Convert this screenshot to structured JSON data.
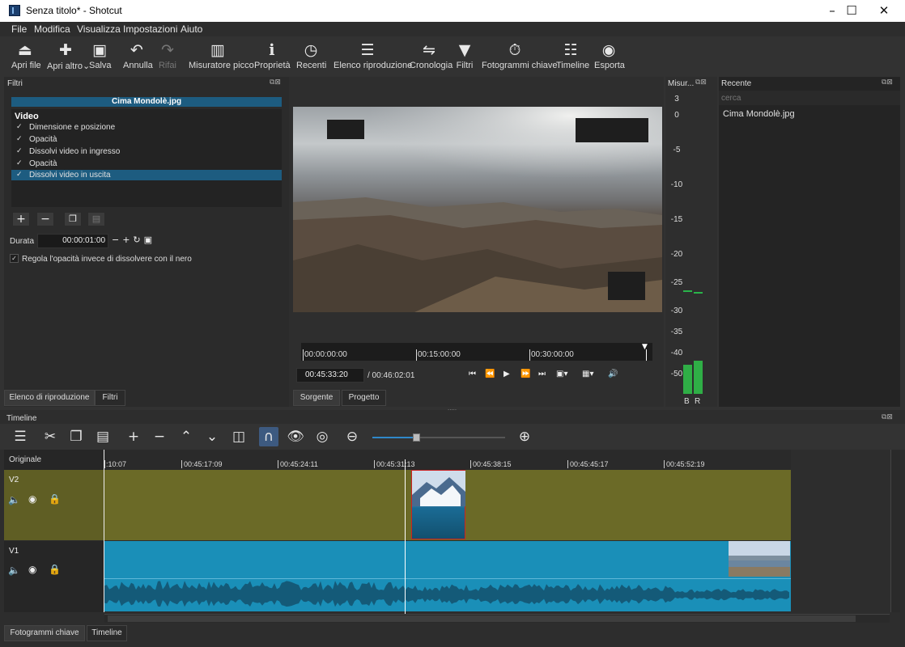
{
  "window": {
    "title": "Senza titolo* - Shotcut",
    "minimize": "–",
    "maximize": "☐",
    "close": "✕"
  },
  "menu": [
    "File",
    "Modifica",
    "Visualizza",
    "Impostazioni",
    "Aiuto"
  ],
  "toolbar": [
    {
      "label": "Apri file",
      "icon": "open-file-icon"
    },
    {
      "label": "Apri altro",
      "icon": "open-other-icon"
    },
    {
      "label": "Salva",
      "icon": "save-icon"
    },
    {
      "label": "Annulla",
      "icon": "undo-icon"
    },
    {
      "label": "Rifai",
      "icon": "redo-icon"
    },
    {
      "label": "Misuratore picco",
      "icon": "peak-meter-icon"
    },
    {
      "label": "Proprietà",
      "icon": "info-icon"
    },
    {
      "label": "Recenti",
      "icon": "clock-icon"
    },
    {
      "label": "Elenco riproduzione",
      "icon": "list-icon"
    },
    {
      "label": "Cronologia",
      "icon": "history-icon"
    },
    {
      "label": "Filtri",
      "icon": "filter-icon"
    },
    {
      "label": "Fotogrammi chiave",
      "icon": "stopwatch-icon"
    },
    {
      "label": "Timeline",
      "icon": "timeline-icon"
    },
    {
      "label": "Esporta",
      "icon": "export-icon"
    }
  ],
  "filters": {
    "panel_title": "Filtri",
    "clip_name": "Cima Mondolè.jpg",
    "section": "Video",
    "items": [
      {
        "label": "Dimensione e posizione",
        "checked": true,
        "selected": false
      },
      {
        "label": "Opacità",
        "checked": true,
        "selected": false
      },
      {
        "label": "Dissolvi video in ingresso",
        "checked": true,
        "selected": false
      },
      {
        "label": "Opacità",
        "checked": true,
        "selected": false
      },
      {
        "label": "Dissolvi video in uscita",
        "checked": true,
        "selected": true
      }
    ],
    "duration_label": "Durata",
    "duration_value": "00:00:01:00",
    "checkbox_label": "Regola l'opacità invece di dissolvere con il nero",
    "tabs": [
      "Elenco di riproduzione",
      "Filtri"
    ]
  },
  "player": {
    "ticks": [
      "00:00:00:00",
      "00:15:00:00",
      "00:30:00:00"
    ],
    "position": "00:45:33:20",
    "duration": "/ 00:46:02:01",
    "tabs": [
      "Sorgente",
      "Progetto"
    ]
  },
  "meter": {
    "title": "Misur...",
    "scale": [
      "3",
      "0",
      "-5",
      "-10",
      "-15",
      "-20",
      "-25",
      "-30",
      "-35",
      "-40",
      "-50"
    ],
    "channels": [
      "B",
      "R"
    ],
    "levels_db": [
      -43,
      -42
    ]
  },
  "recent": {
    "title": "Recente",
    "search_placeholder": "cerca",
    "items": [
      "Cima Mondolè.jpg"
    ]
  },
  "timeline": {
    "title": "Timeline",
    "header_label": "Originale",
    "ruler": [
      ":10:07",
      "00:45:17:09",
      "00:45:24:11",
      "00:45:31:13",
      "00:45:38:15",
      "00:45:45:17",
      "00:45:52:19"
    ],
    "tracks": [
      "V2",
      "V1"
    ],
    "zoom": 0.33
  },
  "bottom_tabs": [
    "Fotogrammi chiave",
    "Timeline"
  ],
  "colors": {
    "accent": "#1d5c80",
    "v2_track": "#6b6a27",
    "v1_clip": "#1a8fb8",
    "meter_green": "#29b34a"
  }
}
